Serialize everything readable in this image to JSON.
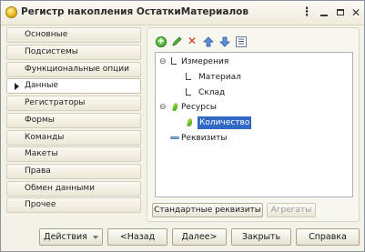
{
  "window": {
    "title": "Регистр накопления ОстаткиМатериалов",
    "more_glyph": "⋮",
    "close_glyph": "✕"
  },
  "sidebar": {
    "items": [
      {
        "label": "Основные"
      },
      {
        "label": "Подсистемы"
      },
      {
        "label": "Функциональные опции"
      },
      {
        "label": "Данные",
        "active": true
      },
      {
        "label": "Регистраторы"
      },
      {
        "label": "Формы"
      },
      {
        "label": "Команды"
      },
      {
        "label": "Макеты"
      },
      {
        "label": "Права"
      },
      {
        "label": "Обмен данными"
      },
      {
        "label": "Прочее"
      }
    ]
  },
  "toolbar": {
    "icons": [
      "add-icon",
      "edit-icon",
      "delete-icon",
      "move-up-icon",
      "move-down-icon",
      "list-icon"
    ],
    "add_glyph": "+",
    "delete_glyph": "✕"
  },
  "tree": {
    "measurements": {
      "label": "Измерения",
      "toggle": "⊖",
      "children": [
        "Материал",
        "Склад"
      ]
    },
    "resources": {
      "label": "Ресурсы",
      "toggle": "⊖",
      "children": [
        "Количество"
      ]
    },
    "requisites": {
      "label": "Реквизиты"
    }
  },
  "panel_buttons": {
    "standard_requisites": "Стандартные реквизиты",
    "aggregates": "Агрегаты"
  },
  "footer": {
    "actions": "Действия",
    "back": "<Назад",
    "next": "Далее>",
    "close": "Закрыть",
    "help": "Справка"
  },
  "colors": {
    "selection": "#3168c6",
    "window_bg": "#f4f1e6"
  }
}
